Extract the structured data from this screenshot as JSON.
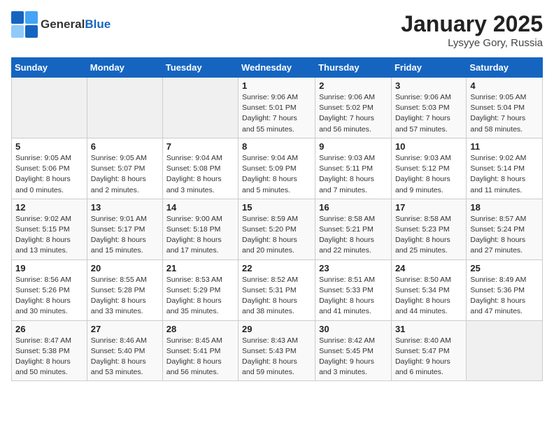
{
  "header": {
    "logo_general": "General",
    "logo_blue": "Blue",
    "title": "January 2025",
    "subtitle": "Lysyye Gory, Russia"
  },
  "weekdays": [
    "Sunday",
    "Monday",
    "Tuesday",
    "Wednesday",
    "Thursday",
    "Friday",
    "Saturday"
  ],
  "weeks": [
    [
      {
        "day": "",
        "info": ""
      },
      {
        "day": "",
        "info": ""
      },
      {
        "day": "",
        "info": ""
      },
      {
        "day": "1",
        "info": "Sunrise: 9:06 AM\nSunset: 5:01 PM\nDaylight: 7 hours\nand 55 minutes."
      },
      {
        "day": "2",
        "info": "Sunrise: 9:06 AM\nSunset: 5:02 PM\nDaylight: 7 hours\nand 56 minutes."
      },
      {
        "day": "3",
        "info": "Sunrise: 9:06 AM\nSunset: 5:03 PM\nDaylight: 7 hours\nand 57 minutes."
      },
      {
        "day": "4",
        "info": "Sunrise: 9:05 AM\nSunset: 5:04 PM\nDaylight: 7 hours\nand 58 minutes."
      }
    ],
    [
      {
        "day": "5",
        "info": "Sunrise: 9:05 AM\nSunset: 5:06 PM\nDaylight: 8 hours\nand 0 minutes."
      },
      {
        "day": "6",
        "info": "Sunrise: 9:05 AM\nSunset: 5:07 PM\nDaylight: 8 hours\nand 2 minutes."
      },
      {
        "day": "7",
        "info": "Sunrise: 9:04 AM\nSunset: 5:08 PM\nDaylight: 8 hours\nand 3 minutes."
      },
      {
        "day": "8",
        "info": "Sunrise: 9:04 AM\nSunset: 5:09 PM\nDaylight: 8 hours\nand 5 minutes."
      },
      {
        "day": "9",
        "info": "Sunrise: 9:03 AM\nSunset: 5:11 PM\nDaylight: 8 hours\nand 7 minutes."
      },
      {
        "day": "10",
        "info": "Sunrise: 9:03 AM\nSunset: 5:12 PM\nDaylight: 8 hours\nand 9 minutes."
      },
      {
        "day": "11",
        "info": "Sunrise: 9:02 AM\nSunset: 5:14 PM\nDaylight: 8 hours\nand 11 minutes."
      }
    ],
    [
      {
        "day": "12",
        "info": "Sunrise: 9:02 AM\nSunset: 5:15 PM\nDaylight: 8 hours\nand 13 minutes."
      },
      {
        "day": "13",
        "info": "Sunrise: 9:01 AM\nSunset: 5:17 PM\nDaylight: 8 hours\nand 15 minutes."
      },
      {
        "day": "14",
        "info": "Sunrise: 9:00 AM\nSunset: 5:18 PM\nDaylight: 8 hours\nand 17 minutes."
      },
      {
        "day": "15",
        "info": "Sunrise: 8:59 AM\nSunset: 5:20 PM\nDaylight: 8 hours\nand 20 minutes."
      },
      {
        "day": "16",
        "info": "Sunrise: 8:58 AM\nSunset: 5:21 PM\nDaylight: 8 hours\nand 22 minutes."
      },
      {
        "day": "17",
        "info": "Sunrise: 8:58 AM\nSunset: 5:23 PM\nDaylight: 8 hours\nand 25 minutes."
      },
      {
        "day": "18",
        "info": "Sunrise: 8:57 AM\nSunset: 5:24 PM\nDaylight: 8 hours\nand 27 minutes."
      }
    ],
    [
      {
        "day": "19",
        "info": "Sunrise: 8:56 AM\nSunset: 5:26 PM\nDaylight: 8 hours\nand 30 minutes."
      },
      {
        "day": "20",
        "info": "Sunrise: 8:55 AM\nSunset: 5:28 PM\nDaylight: 8 hours\nand 33 minutes."
      },
      {
        "day": "21",
        "info": "Sunrise: 8:53 AM\nSunset: 5:29 PM\nDaylight: 8 hours\nand 35 minutes."
      },
      {
        "day": "22",
        "info": "Sunrise: 8:52 AM\nSunset: 5:31 PM\nDaylight: 8 hours\nand 38 minutes."
      },
      {
        "day": "23",
        "info": "Sunrise: 8:51 AM\nSunset: 5:33 PM\nDaylight: 8 hours\nand 41 minutes."
      },
      {
        "day": "24",
        "info": "Sunrise: 8:50 AM\nSunset: 5:34 PM\nDaylight: 8 hours\nand 44 minutes."
      },
      {
        "day": "25",
        "info": "Sunrise: 8:49 AM\nSunset: 5:36 PM\nDaylight: 8 hours\nand 47 minutes."
      }
    ],
    [
      {
        "day": "26",
        "info": "Sunrise: 8:47 AM\nSunset: 5:38 PM\nDaylight: 8 hours\nand 50 minutes."
      },
      {
        "day": "27",
        "info": "Sunrise: 8:46 AM\nSunset: 5:40 PM\nDaylight: 8 hours\nand 53 minutes."
      },
      {
        "day": "28",
        "info": "Sunrise: 8:45 AM\nSunset: 5:41 PM\nDaylight: 8 hours\nand 56 minutes."
      },
      {
        "day": "29",
        "info": "Sunrise: 8:43 AM\nSunset: 5:43 PM\nDaylight: 8 hours\nand 59 minutes."
      },
      {
        "day": "30",
        "info": "Sunrise: 8:42 AM\nSunset: 5:45 PM\nDaylight: 9 hours\nand 3 minutes."
      },
      {
        "day": "31",
        "info": "Sunrise: 8:40 AM\nSunset: 5:47 PM\nDaylight: 9 hours\nand 6 minutes."
      },
      {
        "day": "",
        "info": ""
      }
    ]
  ]
}
